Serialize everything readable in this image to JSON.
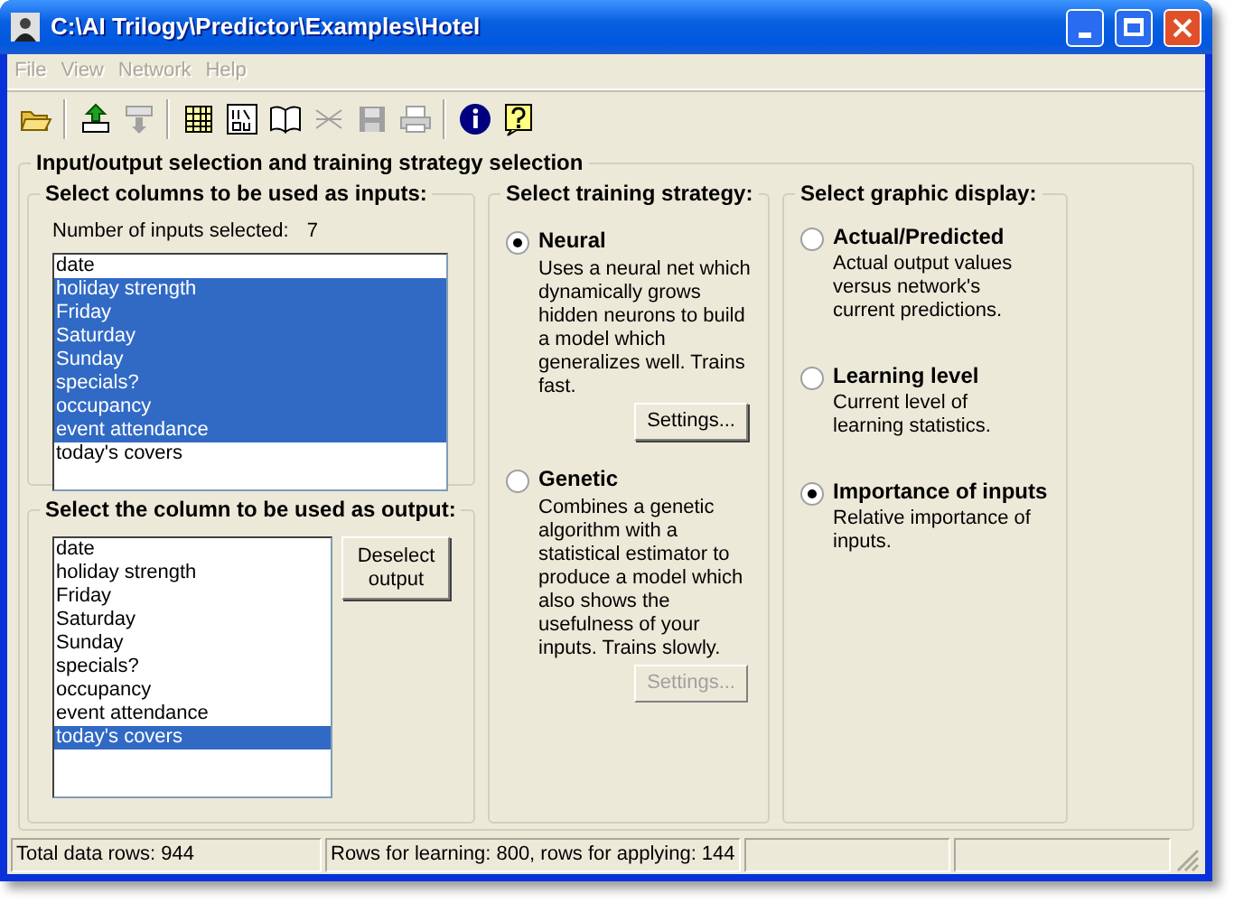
{
  "window": {
    "title": "C:\\AI Trilogy\\Predictor\\Examples\\Hotel"
  },
  "menu": [
    {
      "label": "File",
      "disabled": true
    },
    {
      "label": "View",
      "disabled": true
    },
    {
      "label": "Network",
      "disabled": true
    },
    {
      "label": "Help",
      "disabled": true
    }
  ],
  "toolbar": [
    {
      "kind": "open",
      "disabled": false
    },
    {
      "kind": "separator"
    },
    {
      "kind": "import",
      "disabled": false
    },
    {
      "kind": "export",
      "disabled": true
    },
    {
      "kind": "separator"
    },
    {
      "kind": "table",
      "disabled": false
    },
    {
      "kind": "inout",
      "disabled": false
    },
    {
      "kind": "book",
      "disabled": false
    },
    {
      "kind": "network",
      "disabled": true
    },
    {
      "kind": "save",
      "disabled": true
    },
    {
      "kind": "print",
      "disabled": true
    },
    {
      "kind": "separator"
    },
    {
      "kind": "info",
      "disabled": false
    },
    {
      "kind": "help",
      "disabled": false
    }
  ],
  "main_group": {
    "title": "Input/output selection and training strategy selection"
  },
  "inputs": {
    "title": "Select columns to be used as inputs:",
    "count_label": "Number of inputs selected:",
    "count": "7",
    "items": [
      {
        "label": "date",
        "selected": false
      },
      {
        "label": "holiday strength",
        "selected": true
      },
      {
        "label": "Friday",
        "selected": true
      },
      {
        "label": "Saturday",
        "selected": true
      },
      {
        "label": "Sunday",
        "selected": true
      },
      {
        "label": "specials?",
        "selected": true
      },
      {
        "label": "occupancy",
        "selected": true
      },
      {
        "label": "event attendance",
        "selected": true
      },
      {
        "label": "today's covers",
        "selected": false
      }
    ]
  },
  "output": {
    "title": "Select the column to be used as output:",
    "deselect_button": "Deselect output",
    "items": [
      {
        "label": "date",
        "selected": false
      },
      {
        "label": "holiday strength",
        "selected": false
      },
      {
        "label": "Friday",
        "selected": false
      },
      {
        "label": "Saturday",
        "selected": false
      },
      {
        "label": "Sunday",
        "selected": false
      },
      {
        "label": "specials?",
        "selected": false
      },
      {
        "label": "occupancy",
        "selected": false
      },
      {
        "label": "event attendance",
        "selected": false
      },
      {
        "label": "today's covers",
        "selected": true
      }
    ]
  },
  "strategy": {
    "title": "Select training strategy:",
    "options": [
      {
        "label": "Neural",
        "selected": true,
        "description": "Uses a neural net which dynamically grows hidden neurons to build a model which generalizes well. Trains fast.",
        "settings": {
          "label": "Settings...",
          "disabled": false
        }
      },
      {
        "label": "Genetic",
        "selected": false,
        "description": "Combines a genetic algorithm with a statistical estimator to produce a model which also shows the usefulness of your inputs. Trains slowly.",
        "settings": {
          "label": "Settings...",
          "disabled": true
        }
      }
    ]
  },
  "display": {
    "title": "Select graphic display:",
    "options": [
      {
        "label": "Actual/Predicted",
        "selected": false,
        "description": "Actual output values versus network's current predictions."
      },
      {
        "label": "Learning level",
        "selected": false,
        "description": "Current level of learning statistics."
      },
      {
        "label": "Importance of inputs",
        "selected": true,
        "description": "Relative importance of inputs."
      }
    ]
  },
  "status_bar": {
    "panels": [
      "Total data rows: 944",
      "Rows for learning: 800, rows for applying: 144"
    ]
  }
}
